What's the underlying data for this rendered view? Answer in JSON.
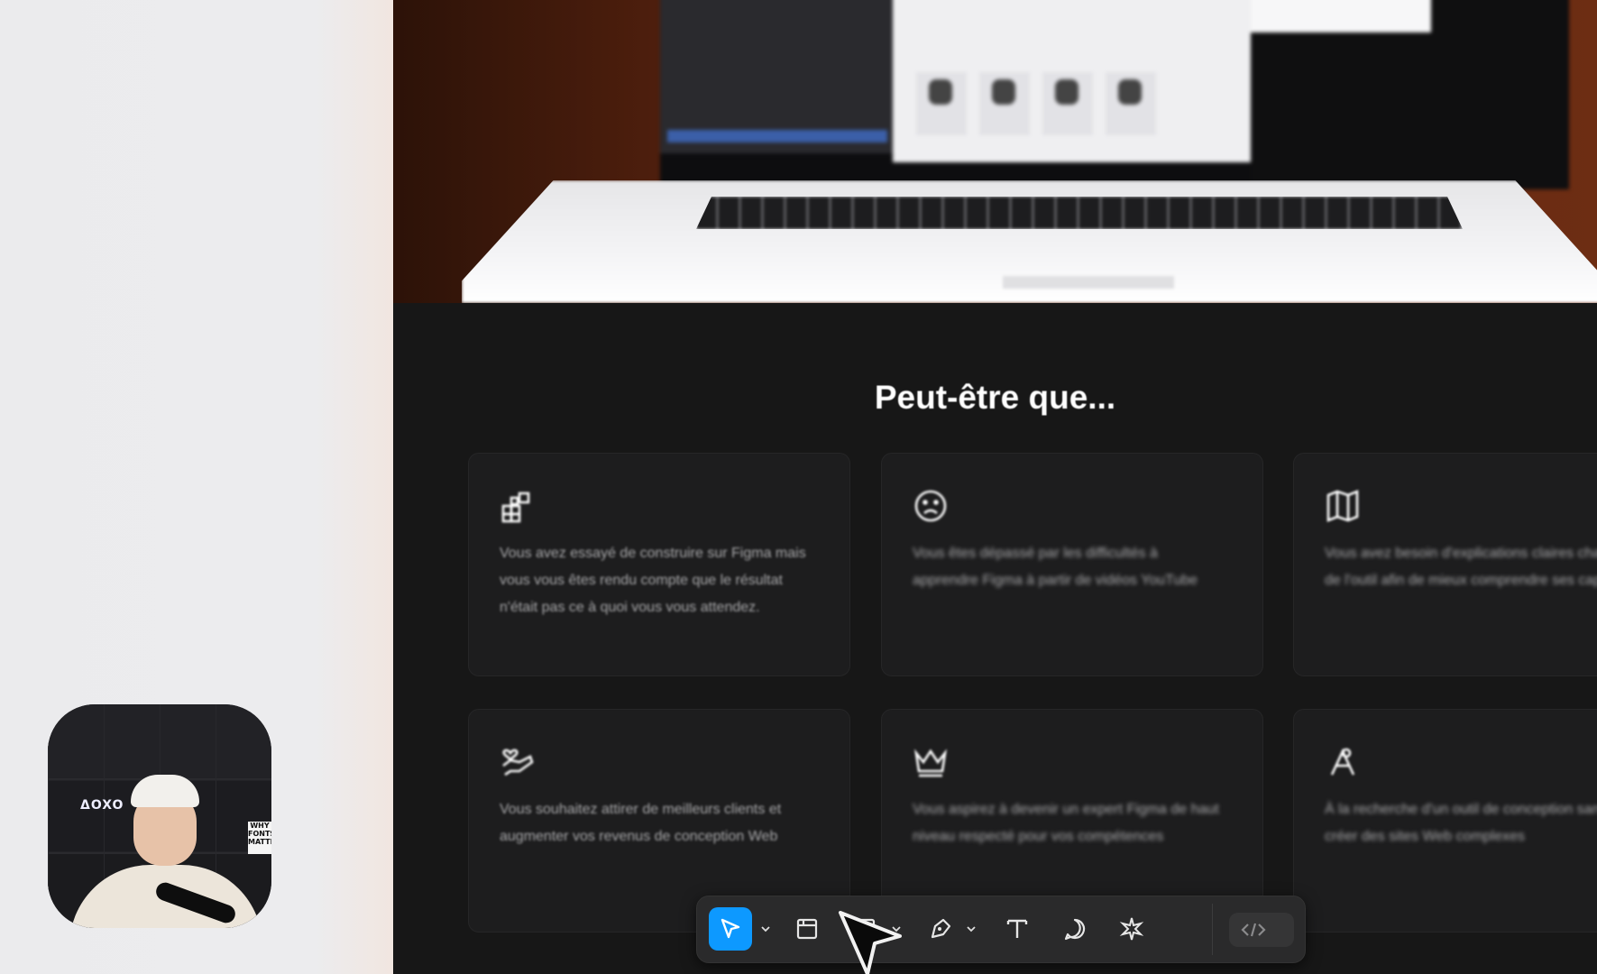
{
  "section": {
    "title": "Peut-être que..."
  },
  "cards": [
    {
      "icon": "blocks-icon",
      "text": "Vous avez essayé de construire sur Figma mais vous vous êtes rendu compte que le résultat n'était pas ce à quoi vous vous attendez."
    },
    {
      "icon": "sad-face-icon",
      "text": "Vous êtes dépassé par les difficultés à apprendre Figma à partir de vidéos YouTube"
    },
    {
      "icon": "map-icon",
      "text": "Vous avez besoin d'explications claires chaque parties de l'outil afin de mieux comprendre ses capacités"
    },
    {
      "icon": "hand-heart-icon",
      "text": "Vous souhaitez attirer de meilleurs clients et augmenter vos revenus de conception Web"
    },
    {
      "icon": "crown-icon",
      "text": "Vous aspirez à devenir un expert Figma de haut niveau respecté pour vos compétences"
    },
    {
      "icon": "pen-nib-icon",
      "text": "À la recherche d'un outil de conception sans code pour créer des sites Web complexes"
    }
  ],
  "webcam": {
    "logo_text": "ΔOXO",
    "sign_text": "WHY FONTS MATTER"
  },
  "toolbar": {
    "tools": [
      "move-icon",
      "frame-icon",
      "rectangle-icon",
      "pen-icon",
      "text-icon",
      "comment-icon",
      "actions-icon"
    ],
    "active_tool": "move-icon",
    "accent": "#0d99ff"
  }
}
